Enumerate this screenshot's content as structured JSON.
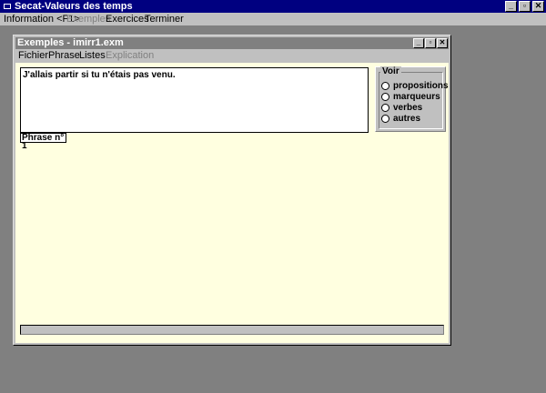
{
  "app": {
    "title": "Secat-Valeurs des temps",
    "window_buttons": [
      "_",
      "▫",
      "✕"
    ]
  },
  "menubar": {
    "items": [
      {
        "label": "Information <F1>"
      },
      {
        "label": "Exemples",
        "disabled": true
      },
      {
        "label": "Exercices"
      },
      {
        "label": "Terminer"
      }
    ]
  },
  "child_window": {
    "title": "Exemples - imirr1.exm",
    "menu": [
      {
        "label": "Fichier"
      },
      {
        "label": "Phrase"
      },
      {
        "label": "Listes"
      },
      {
        "label": "Explication",
        "disabled": true
      }
    ]
  },
  "sentence": {
    "text": "J'allais partir si tu n'étais pas venu."
  },
  "phrase_number": "Phrase n° 1",
  "voir": {
    "title": "Voir",
    "options": [
      "propositions",
      "marqueurs",
      "verbes",
      "autres"
    ]
  }
}
